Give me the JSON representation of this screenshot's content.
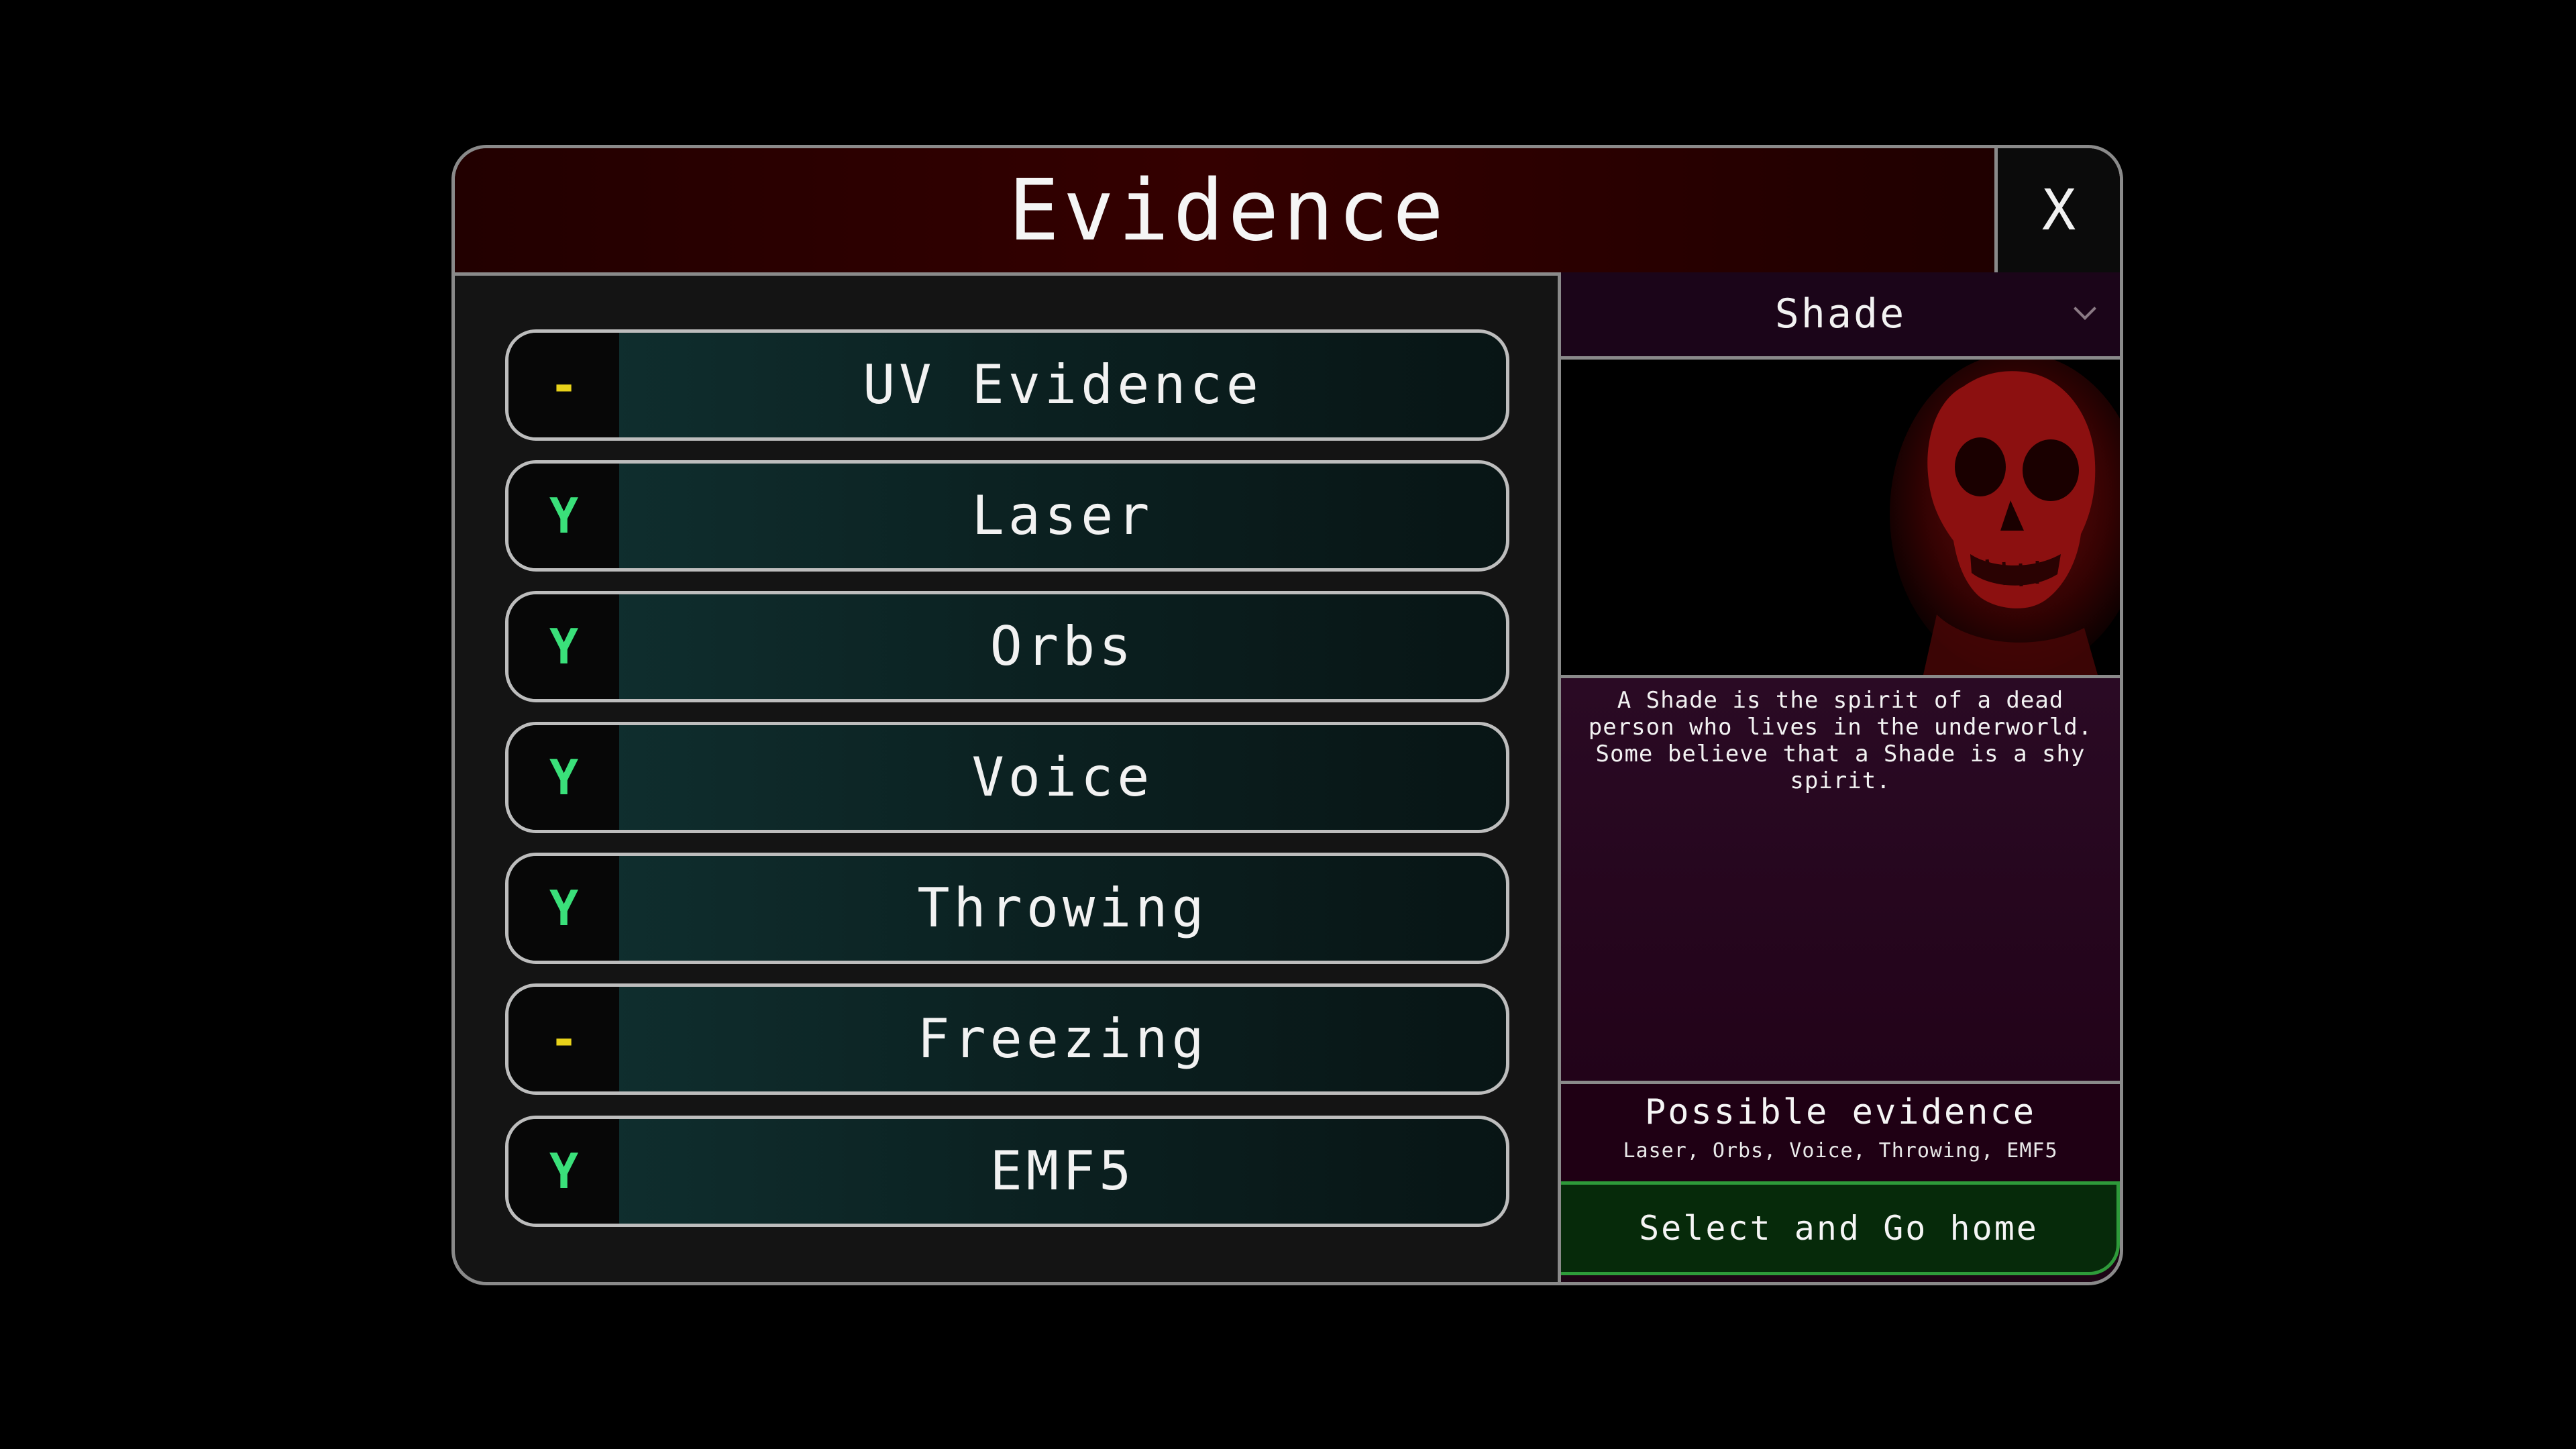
{
  "dialog": {
    "title": "Evidence",
    "close_label": "X"
  },
  "evidence": [
    {
      "status": "-",
      "status_type": "maybe",
      "label": "UV Evidence"
    },
    {
      "status": "Y",
      "status_type": "yes",
      "label": "Laser"
    },
    {
      "status": "Y",
      "status_type": "yes",
      "label": "Orbs"
    },
    {
      "status": "Y",
      "status_type": "yes",
      "label": "Voice"
    },
    {
      "status": "Y",
      "status_type": "yes",
      "label": "Throwing"
    },
    {
      "status": "-",
      "status_type": "maybe",
      "label": "Freezing"
    },
    {
      "status": "Y",
      "status_type": "yes",
      "label": "EMF5"
    }
  ],
  "ghost": {
    "selected": "Shade",
    "description": "A Shade is the spirit of a dead person who lives in the underworld. Some believe that a Shade is a shy spirit.",
    "possible_title": "Possible evidence",
    "possible_list": "Laser, Orbs, Voice, Throwing, EMF5"
  },
  "actions": {
    "select_go_home": "Select and Go home"
  },
  "colors": {
    "yes": "#3ae07a",
    "maybe": "#e8d21a",
    "header_bg": "#340000",
    "go_border": "#2e9a3a"
  }
}
